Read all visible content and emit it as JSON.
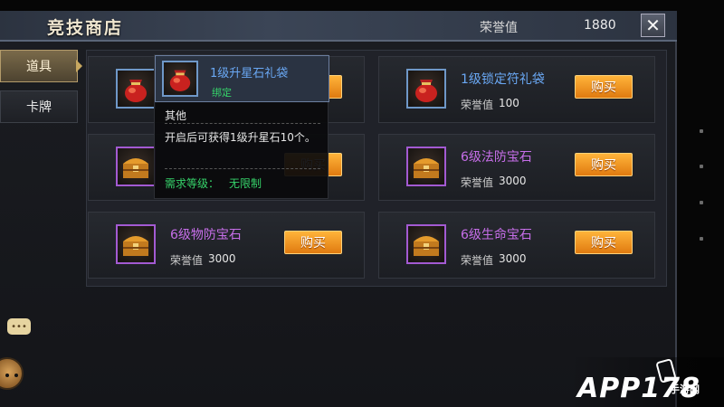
{
  "header": {
    "title": "竞技商店",
    "honor_label": "荣誉值",
    "honor_value": "1880",
    "close_symbol": "✕"
  },
  "sidebar": {
    "tabs": [
      {
        "label": "道具",
        "active": true
      },
      {
        "label": "卡牌",
        "active": false
      }
    ]
  },
  "shop": {
    "price_label": "荣誉值",
    "buy_label": "购买",
    "items": [
      {
        "name": "1级升星石礼袋",
        "price": "",
        "rarity_color": "#6aa8f4",
        "icon": "red-pouch-icon"
      },
      {
        "name": "1级锁定符礼袋",
        "price": "100",
        "rarity_color": "#6aa8f4",
        "icon": "red-pouch-icon"
      },
      {
        "name": "",
        "price": "",
        "rarity_color": "#c66ee8",
        "icon": "treasure-chest-icon"
      },
      {
        "name": "6级法防宝石",
        "price": "3000",
        "rarity_color": "#c66ee8",
        "icon": "treasure-chest-icon"
      },
      {
        "name": "6级物防宝石",
        "price": "3000",
        "rarity_color": "#c66ee8",
        "icon": "treasure-chest-icon"
      },
      {
        "name": "6级生命宝石",
        "price": "3000",
        "rarity_color": "#c66ee8",
        "icon": "treasure-chest-icon"
      }
    ]
  },
  "tooltip": {
    "name": "1级升星石礼袋",
    "bind": "绑定",
    "category": "其他",
    "description": "开启后可获得1级升星石10个。",
    "requirement_label": "需求等级：",
    "requirement_value": "无限制"
  },
  "watermark": {
    "main": "APP178",
    "sub": "手游网"
  },
  "colors": {
    "buy_button": "#f39a22",
    "blue_rarity": "#6aa8f4",
    "purple_rarity": "#c66ee8",
    "green_text": "#36d36a"
  }
}
